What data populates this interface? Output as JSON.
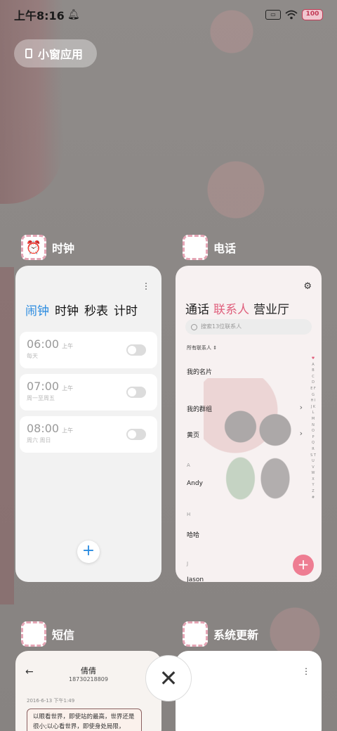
{
  "status_bar": {
    "time": "上午8:16",
    "battery": "100"
  },
  "small_window": {
    "label": "小窗应用"
  },
  "apps": {
    "clock": {
      "name": "时钟",
      "tabs": [
        "闹钟",
        "时钟",
        "秒表",
        "计时"
      ],
      "alarms": [
        {
          "time": "06:00",
          "ampm": "上午",
          "repeat": "每天"
        },
        {
          "time": "07:00",
          "ampm": "上午",
          "repeat": "周一至周五"
        },
        {
          "time": "08:00",
          "ampm": "上午",
          "repeat": "周六 周日"
        }
      ]
    },
    "phone": {
      "name": "电话",
      "tabs": [
        "通话",
        "联系人",
        "营业厅"
      ],
      "search_placeholder": "搜索13位联系人",
      "filter": "所有联系人",
      "rows": {
        "my_card": "我的名片",
        "my_groups": "我的群组",
        "yellow_pages": "黄页"
      },
      "letters": {
        "a": "A",
        "h": "H",
        "j": "J"
      },
      "contacts": {
        "andy": "Andy",
        "haha": "哈哈",
        "jason": "Jason"
      },
      "alpha_index": "A B C D E F G H I J K L M N O P Q R S T U V W X Y Z #"
    },
    "sms": {
      "name": "短信",
      "contact_name": "倩倩",
      "contact_number": "18730218809",
      "date": "2016-6-13 下午1:49",
      "message": "以眼看世界，即使站的最高，世界还是很小;以心看世界，即使身处局限，"
    },
    "update": {
      "name": "系统更新"
    }
  }
}
